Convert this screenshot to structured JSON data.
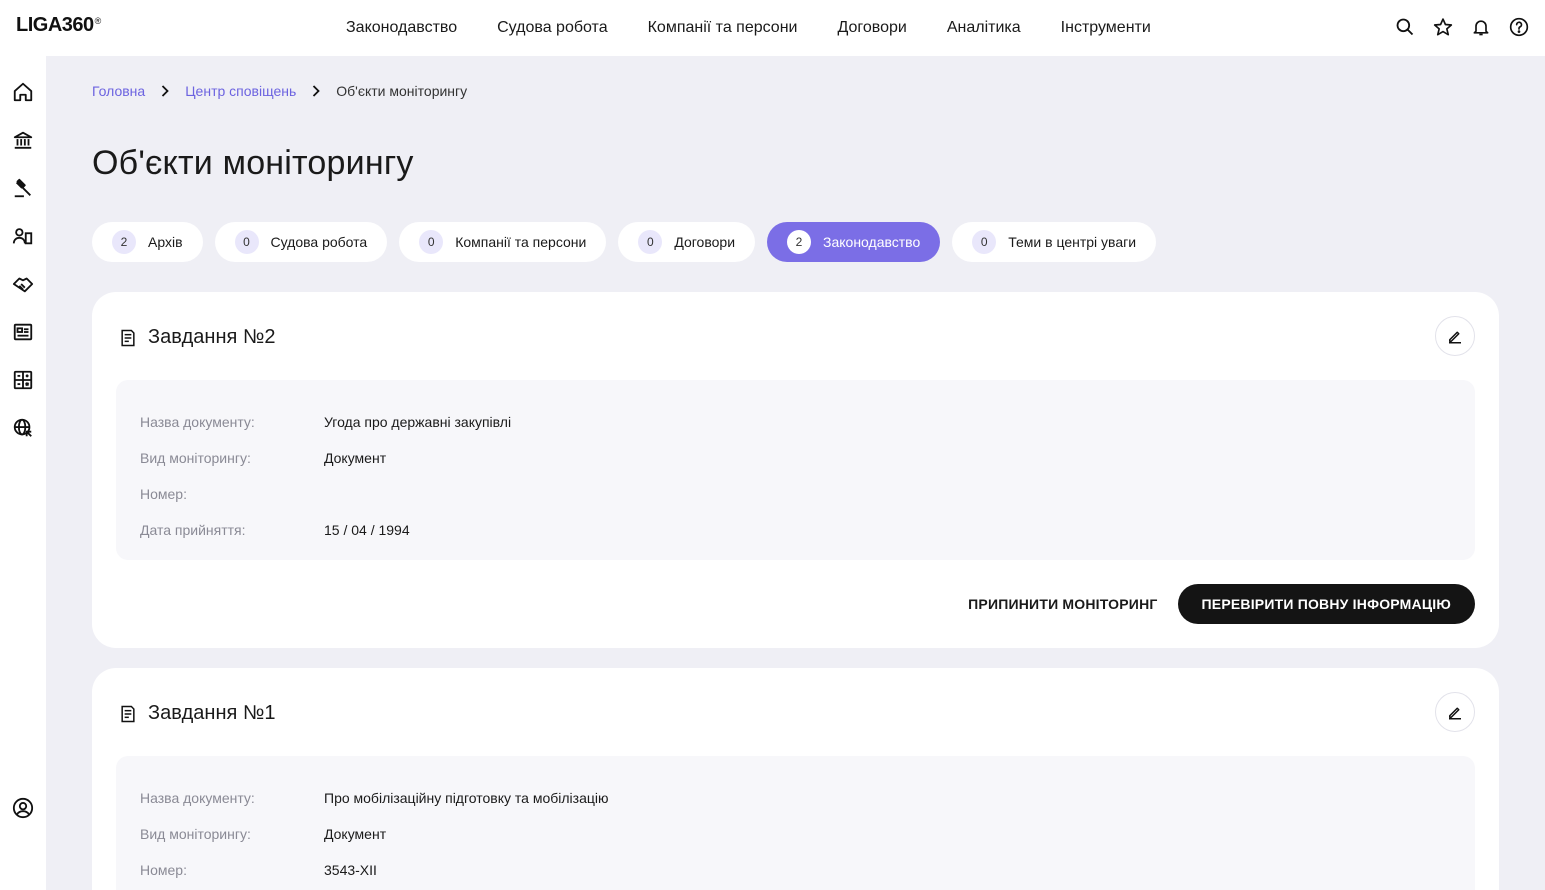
{
  "logo": {
    "text": "LIGA360",
    "mark": "®"
  },
  "nav": [
    "Законодавство",
    "Судова робота",
    "Компанії та персони",
    "Договори",
    "Аналітика",
    "Інструменти"
  ],
  "top_icons": [
    "search-icon",
    "star-icon",
    "bell-icon",
    "help-icon"
  ],
  "sidebar_icons": [
    "home-icon",
    "bank-icon",
    "gavel-icon",
    "people-icon",
    "handshake-icon",
    "newspaper-icon",
    "calculator-icon",
    "globe-icon",
    "user-circle-icon"
  ],
  "breadcrumb": {
    "home": "Головна",
    "center": "Центр сповіщень",
    "current": "Об'єкти моніторингу"
  },
  "page_title": "Об'єкти моніторингу",
  "tabs": [
    {
      "count": "2",
      "label": "Архів"
    },
    {
      "count": "0",
      "label": "Судова робота"
    },
    {
      "count": "0",
      "label": "Компанії та персони"
    },
    {
      "count": "0",
      "label": "Договори"
    },
    {
      "count": "2",
      "label": "Законодавство"
    },
    {
      "count": "0",
      "label": "Теми в центрі уваги"
    }
  ],
  "active_tab": "Законодавство",
  "labels": {
    "doc_name": "Назва документу:",
    "monitoring_type": "Вид моніторингу:",
    "number": "Номер:",
    "adoption_date": "Дата прийняття:"
  },
  "cards": [
    {
      "title": "Завдання №2",
      "doc_name": "Угода про державні закупівлі",
      "monitoring_type": "Документ",
      "number": "",
      "adoption_date": "15 / 04 / 1994",
      "stop_label": "ПРИПИНИТИ МОНІТОРИНГ",
      "check_label": "ПЕРЕВІРИТИ ПОВНУ ІНФОРМАЦІЮ"
    },
    {
      "title": "Завдання №1",
      "doc_name": "Про мобілізаційну підготовку та мобілізацію",
      "monitoring_type": "Документ",
      "number": "3543-XII"
    }
  ],
  "colors": {
    "accent": "#7b6ee6",
    "link": "#6c63e0",
    "dark_button": "#141414",
    "background": "#efeff5"
  }
}
